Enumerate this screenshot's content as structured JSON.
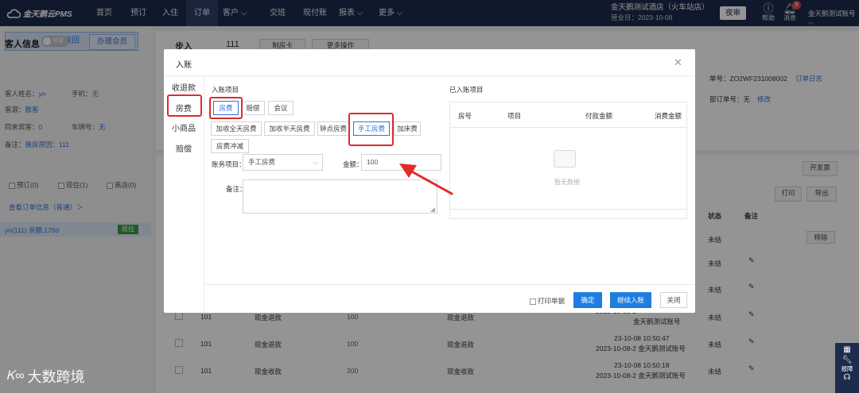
{
  "topnav": {
    "logo": "金天鹅云PMS",
    "items": [
      "首页",
      "预订",
      "入住",
      "订单",
      "客户",
      "交班",
      "现付账",
      "报表",
      "更多"
    ],
    "active_index": 3,
    "hotel_name": "金天鹅测试酒店（火车站店）",
    "business_date": "营业日：2023-10-08",
    "night_audit": "夜审",
    "help": "帮助",
    "messages": "消息",
    "message_count": "9",
    "account": "金天鹅测试账号"
  },
  "left": {
    "back": "返回",
    "customer_info": "客人信息",
    "toggle": "保密",
    "member": "办理会员",
    "name_label": "客人姓名：",
    "name": "yn",
    "phone_label": "手机：",
    "phone": "无",
    "source_label": "客源：",
    "source": "散客",
    "guests_label": "同来宾客：",
    "guests": "0",
    "plate_label": "车牌号：",
    "plate": "无",
    "remark_label": "备注：",
    "remark": "换房原因：111",
    "filters": [
      "预订(0)",
      "现住(1)",
      "离店(0)"
    ],
    "order_link": "查看订单信息（普通）＞",
    "room_line": "yn(111)  余额:1750",
    "room_status": "现住"
  },
  "main": {
    "tab": "步入",
    "room_no": "111",
    "card_btn": "制房卡",
    "more_ops": "更多操作",
    "order_no": "单号：ZO2WF231008002",
    "order_log": "订单日志",
    "ext_no_label": "部订单号：无",
    "ext_no_edit": "修改",
    "invoice": "开发票",
    "print": "打印",
    "export": "导出",
    "col_status": "状态",
    "col_remark": "备注",
    "remove": "移除",
    "rows": [
      {
        "room": "",
        "item": "",
        "amount": "",
        "item2": "",
        "time": "",
        "user": "",
        "status": "未结"
      },
      {
        "room": "",
        "item": "",
        "amount": "",
        "item2": "",
        "time": "",
        "user": "",
        "status": "未结"
      },
      {
        "room": "",
        "item": "",
        "amount": "",
        "item2": "",
        "time": "",
        "user": "",
        "status": "未结"
      },
      {
        "room": "101",
        "item": "现金退款",
        "amount": "100",
        "item2": "现金退款",
        "time": "2023-10-08-2",
        "user": "金天鹅测试账号",
        "status": "未结"
      },
      {
        "room": "101",
        "item": "现金退款",
        "amount": "100",
        "item2": "现金退款",
        "time": "23-10-08 10:50:47",
        "user": "2023-10-08-2 金天鹅测试账号",
        "status": "未结"
      },
      {
        "room": "101",
        "item": "现金收款",
        "amount": "200",
        "item2": "现金收款",
        "time": "23-10-08 10:50:18",
        "user": "2023-10-08-2 金天鹅测试账号",
        "status": "未结"
      }
    ]
  },
  "modal": {
    "title": "入账",
    "side": [
      "收退款",
      "房费",
      "小商品",
      "赔偿"
    ],
    "section_left": "入账项目",
    "section_right": "已入账项目",
    "cat_tabs": [
      "房费",
      "赔偿",
      "会议"
    ],
    "items": [
      "加收全天房费",
      "加收半天房费",
      "钟点房费",
      "手工房费",
      "加床费",
      "房费冲减"
    ],
    "account_item_label": "账务项目：",
    "account_item_value": "手工房费",
    "amount_label": "金额：",
    "amount_value": "100",
    "remark_label": "备注：",
    "table_headers": [
      "房号",
      "项目",
      "付款金额",
      "消费金额"
    ],
    "empty": "暂无数据",
    "print_receipt": "打印单据",
    "confirm": "确定",
    "continue": "继续入账",
    "close": "关闭"
  },
  "watermark": "大数跨境",
  "rail": {
    "report": "报障"
  },
  "colors": {
    "nav": "#1d2b4c",
    "primary": "#1f7de0",
    "annotation": "#e02b2b"
  }
}
